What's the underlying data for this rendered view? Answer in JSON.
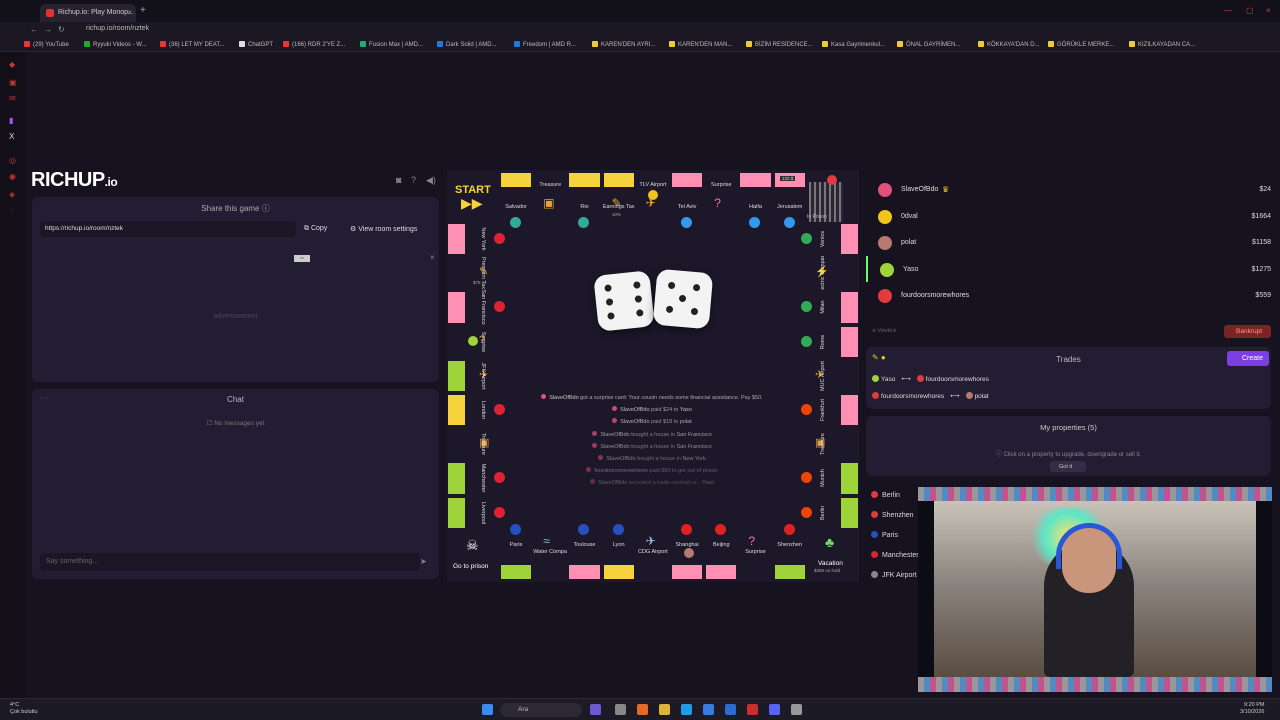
{
  "browser": {
    "tab_title": "Richup.io: Play Monop...",
    "url": "richup.io/room/nztek",
    "bookmarks": [
      "(29) YouTube",
      "Ryyuki Videos - W...",
      "(36) LET MY DEAT...",
      "ChatGPT",
      "(166) RDR 2'YE Z...",
      "Fusion Max | AMD...",
      "Dark Solid | AMD...",
      "Freedom | AMD R...",
      "KAREN'DEN AYRI...",
      "KAREN'DEN MAN...",
      "BİZİM RESİDENCE...",
      "Kasa Gayrimenkul...",
      "ÖNAL GAYRİMEN...",
      "KÖKKAYA'DAN D...",
      "GÖRÜKLE MERKE...",
      "KIZILKAYADAN CA..."
    ]
  },
  "brand": {
    "name": "RICHUP",
    "suffix": ".io"
  },
  "share": {
    "title": "Share this game",
    "url": "https://richup.io/room/nztek",
    "copy_label": "Copy",
    "settings_label": "View room settings",
    "ad_label": "advertisement"
  },
  "chat": {
    "title": "Chat",
    "empty": "No messages yet",
    "placeholder": "Say something..."
  },
  "board": {
    "corners": {
      "start": "START",
      "prison": "In Prison",
      "go_to_prison": "Go to prison",
      "vacation": "Vacation",
      "vacation_note": "$365 on hold"
    },
    "top": [
      "Salvador",
      "Treasure",
      "Rio",
      "Earnings Tax",
      "TLV Airport",
      "Tel Aviv",
      "Surprise",
      "Haifa",
      "Jerusalem"
    ],
    "bottom": [
      "Paris",
      "Water Company",
      "Toulouse",
      "Lyon",
      "CDG Airport",
      "Shanghai",
      "Beijing",
      "Surprise",
      "Shenzhen"
    ],
    "left": [
      "New York",
      "Premium Tax",
      "San Francisco",
      "Surprise",
      "JFK Airport",
      "London",
      "Treasure",
      "Manchester",
      "Liverpool"
    ],
    "right": [
      "Venice",
      "Electric Company",
      "Milan",
      "Rome",
      "MUC Airport",
      "Frankfurt",
      "Treasure",
      "Munich",
      "Berlin"
    ],
    "earnings_tax_note": "10%",
    "premium_tax_note": "$75",
    "haifa_price": "120 $"
  },
  "log": [
    {
      "who": "SlaveOfBdo",
      "text": "got a surprise card: Your cousin needs some financial assistance. Pay $50."
    },
    {
      "who": "SlaveOfBdo",
      "text": "paid $24 to",
      "target": "Yaso"
    },
    {
      "who": "SlaveOfBdo",
      "text": "paid $18 to",
      "target": "polat"
    },
    {
      "who": "SlaveOfBdo",
      "text": "bought a house in",
      "target": "San Francisco"
    },
    {
      "who": "SlaveOfBdo",
      "text": "bought a house in",
      "target": "San Francisco"
    },
    {
      "who": "SlaveOfBdo",
      "text": "bought a house in",
      "target": "New York"
    },
    {
      "who": "fourdoorsmorewhores",
      "text": "paid $50 to get out of prison"
    },
    {
      "who": "SlaveOfBdo",
      "text": "accepted a trade contract w...",
      "target": "Yaso"
    }
  ],
  "players": [
    {
      "name": "SlaveOfBdo",
      "money": "$24",
      "color": "#e0507a"
    },
    {
      "name": "0dval",
      "money": "$1664",
      "color": "#f0c419"
    },
    {
      "name": "polat",
      "money": "$1158",
      "color": "#b87a6e"
    },
    {
      "name": "Yaso",
      "money": "$1275",
      "color": "#9fd33a"
    },
    {
      "name": "fourdoorsmorewhores",
      "money": "$559",
      "color": "#e03c3c"
    }
  ],
  "controls": {
    "votekick": "Votekick",
    "bankrupt": "Bankrupt"
  },
  "trades": {
    "title": "Trades",
    "create_label": "Create",
    "items": [
      {
        "from": "Yaso",
        "to": "fourdoorsmorewhores"
      },
      {
        "from": "fourdoorsmorewhores",
        "to": "polat"
      }
    ]
  },
  "my_properties": {
    "title": "My properties (5)",
    "hint": "Click on a property to upgrade, downgrade or sell it.",
    "got_it": "Got it",
    "items": [
      "Berlin",
      "Shenzhen",
      "Paris",
      "Manchester",
      "JFK Airport"
    ]
  },
  "taskbar": {
    "weather_temp": "4°C",
    "weather_desc": "Çok bulutlu",
    "search": "Ara",
    "time": "9:20 PM",
    "date": "3/10/2026"
  },
  "colors": {
    "accent": "#7b3fe4",
    "panel": "#221d33",
    "background": "#16121f",
    "bankrupt": "#7a2424"
  }
}
